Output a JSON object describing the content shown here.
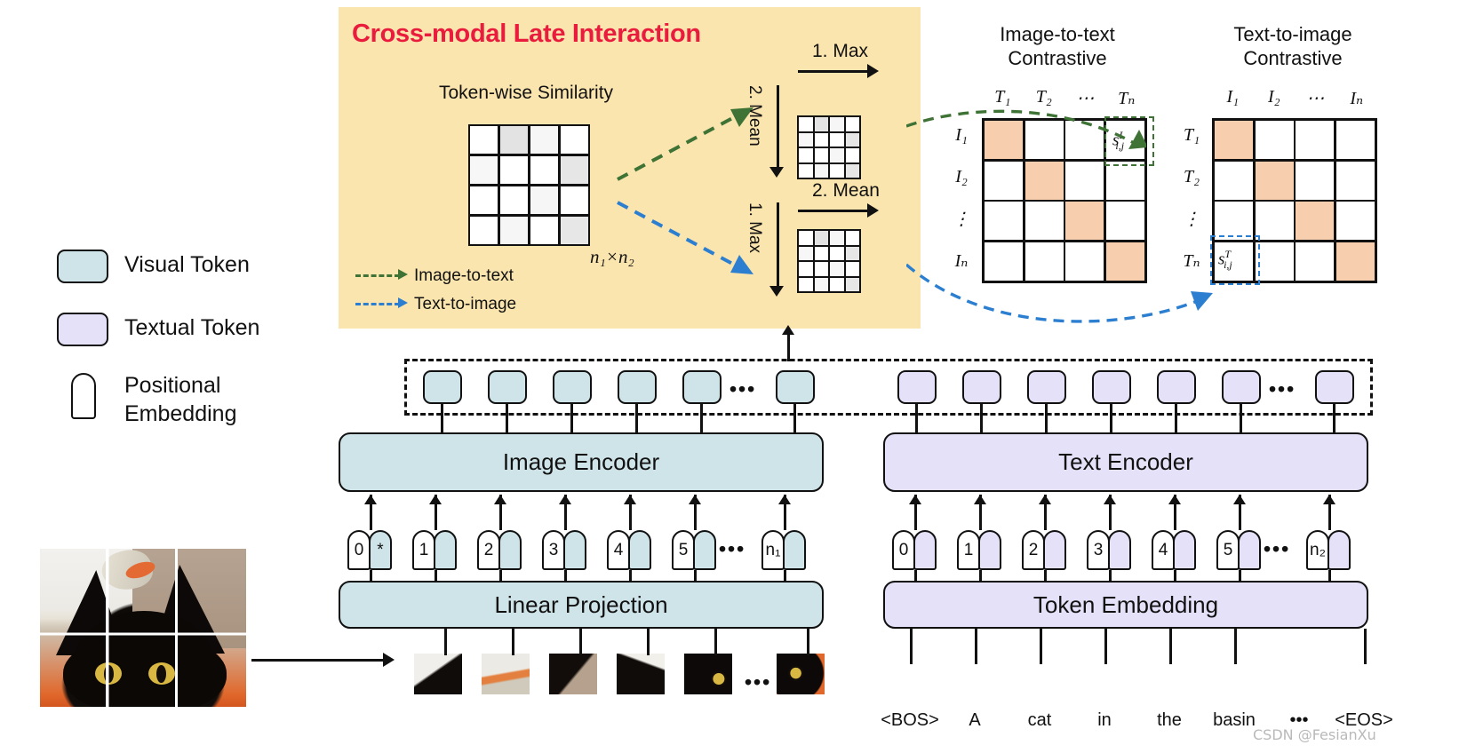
{
  "panel": {
    "title": "Cross-modal Late Interaction",
    "similarity_title": "Token-wise Similarity",
    "dims_label": "n₁×n₂",
    "legend": [
      {
        "key": "image-to-text",
        "label": "Image-to-text",
        "color": "#3f7336"
      },
      {
        "key": "text-to-image",
        "label": "Text-to-image",
        "color": "#2c7fd0"
      }
    ],
    "ops": {
      "top_horizontal": "1. Max",
      "top_vertical": "2. Mean",
      "bottom_horizontal": "2. Mean",
      "bottom_vertical": "1. Max"
    },
    "similarity_matrix": {
      "rows": 4,
      "cols": 4,
      "shades": [
        [
          0.0,
          0.18,
          0.06,
          0.0
        ],
        [
          0.05,
          0.0,
          0.0,
          0.16
        ],
        [
          0.0,
          0.0,
          0.06,
          0.0
        ],
        [
          0.0,
          0.06,
          0.0,
          0.15
        ]
      ]
    }
  },
  "contrastive": {
    "image_to_text": {
      "title_line1": "Image-to-text",
      "title_line2": "Contrastive",
      "col_headers": [
        "T₁",
        "T₂",
        "⋯",
        "Tₙ"
      ],
      "row_headers": [
        "I₁",
        "I₂",
        "⋮",
        "Iₙ"
      ],
      "diagonal_color": "#f8cfae",
      "score_label": "s",
      "score_sup": "I",
      "score_sub": "i,j"
    },
    "text_to_image": {
      "title_line1": "Text-to-image",
      "title_line2": "Contrastive",
      "col_headers": [
        "I₁",
        "I₂",
        "⋯",
        "Iₙ"
      ],
      "row_headers": [
        "T₁",
        "T₂",
        "⋮",
        "Tₙ"
      ],
      "diagonal_color": "#f8cfae",
      "score_label": "s",
      "score_sup": "T",
      "score_sub": "i,j"
    }
  },
  "legend_left": {
    "visual_token": "Visual Token",
    "textual_token": "Textual Token",
    "positional_embedding_line1": "Positional",
    "positional_embedding_line2": "Embedding",
    "visual_color": "#cfe4e8",
    "textual_color": "#e4e1f8"
  },
  "image_branch": {
    "encoder_label": "Image Encoder",
    "projection_label": "Linear Projection",
    "position_ids": [
      "0",
      "1",
      "2",
      "3",
      "4",
      "5",
      "n₁"
    ],
    "cls_marker": "*",
    "ellipsis": "•••",
    "token_count": 6
  },
  "text_branch": {
    "encoder_label": "Text Encoder",
    "embedding_label": "Token Embedding",
    "position_ids": [
      "0",
      "1",
      "2",
      "3",
      "4",
      "5",
      "n₂"
    ],
    "words": [
      "<BOS>",
      "A",
      "cat",
      "in",
      "the",
      "basin",
      "•••",
      "<EOS>"
    ],
    "ellipsis": "•••",
    "token_count": 7
  },
  "watermark": "CSDN @FesianXu"
}
